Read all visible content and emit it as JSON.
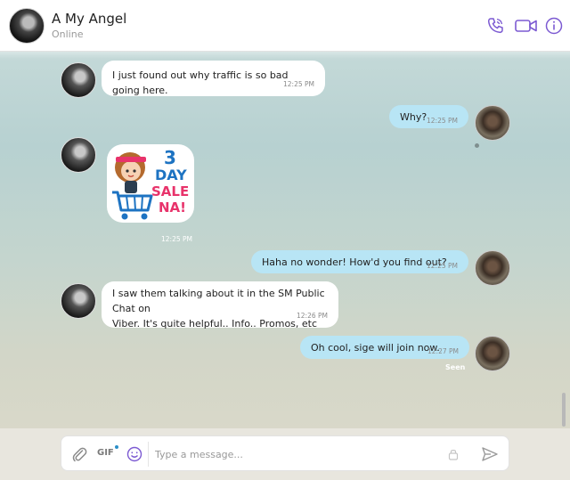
{
  "header": {
    "contact_name": "A My Angel",
    "status": "Online",
    "icons": [
      "phone-icon",
      "video-icon",
      "info-icon"
    ],
    "accent_color": "#7c5ad2"
  },
  "messages": [
    {
      "direction": "incoming",
      "type": "text",
      "text": "I just found out why traffic is so bad going here.",
      "time": "12:25 PM"
    },
    {
      "direction": "outgoing",
      "type": "text",
      "text": "Why?",
      "time": "12:25 PM"
    },
    {
      "direction": "incoming",
      "type": "sticker",
      "sticker_text": [
        "3",
        "DAY",
        "SALE",
        "NA!"
      ],
      "time": "12:25 PM"
    },
    {
      "direction": "outgoing",
      "type": "text",
      "text": "Haha no wonder! How'd you find out?",
      "time": "12:25 PM"
    },
    {
      "direction": "incoming",
      "type": "text",
      "lines": [
        "I saw them talking about it in the SM Public Chat on",
        "Viber. It's quite helpful.. Info.. Promos, etc"
      ],
      "time": "12:26 PM"
    },
    {
      "direction": "outgoing",
      "type": "text",
      "text": "Oh cool, sige will join now.",
      "time": "12:27 PM",
      "receipt": "Seen"
    }
  ],
  "composer": {
    "placeholder": "Type a message...",
    "gif_label": "GIF",
    "icons": [
      "attach-icon",
      "gif-icon",
      "smiley-icon",
      "lock-icon",
      "send-icon"
    ]
  },
  "colors": {
    "outgoing_bubble": "#b8e5f5",
    "incoming_bubble": "#ffffff"
  }
}
